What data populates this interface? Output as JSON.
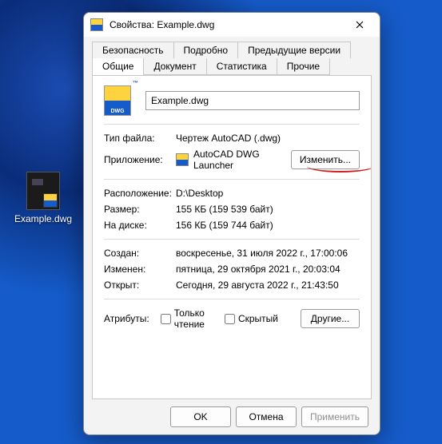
{
  "desktop": {
    "file_label": "Example.dwg"
  },
  "dialog": {
    "title": "Свойства: Example.dwg",
    "tabs_top": [
      "Безопасность",
      "Подробно",
      "Предыдущие версии"
    ],
    "tabs_bottom": [
      "Общие",
      "Документ",
      "Статистика",
      "Прочие"
    ],
    "active_tab": "Общие",
    "filename": "Example.dwg",
    "rows": {
      "filetype_label": "Тип файла:",
      "filetype_value": "Чертеж AutoCAD (.dwg)",
      "app_label": "Приложение:",
      "app_value": "AutoCAD DWG Launcher",
      "change_btn": "Изменить...",
      "location_label": "Расположение:",
      "location_value": "D:\\Desktop",
      "size_label": "Размер:",
      "size_value": "155 КБ (159 539 байт)",
      "ondisk_label": "На диске:",
      "ondisk_value": "156 КБ (159 744 байт)",
      "created_label": "Создан:",
      "created_value": "воскресенье, 31 июля 2022 г., 17:00:06",
      "modified_label": "Изменен:",
      "modified_value": "пятница, 29 октября 2021 г., 20:03:04",
      "accessed_label": "Открыт:",
      "accessed_value": "Сегодня, 29 августа 2022 г., 21:43:50",
      "attrs_label": "Атрибуты:",
      "readonly_label": "Только чтение",
      "hidden_label": "Скрытый",
      "advanced_btn": "Другие..."
    },
    "footer": {
      "ok": "OK",
      "cancel": "Отмена",
      "apply": "Применить"
    }
  }
}
